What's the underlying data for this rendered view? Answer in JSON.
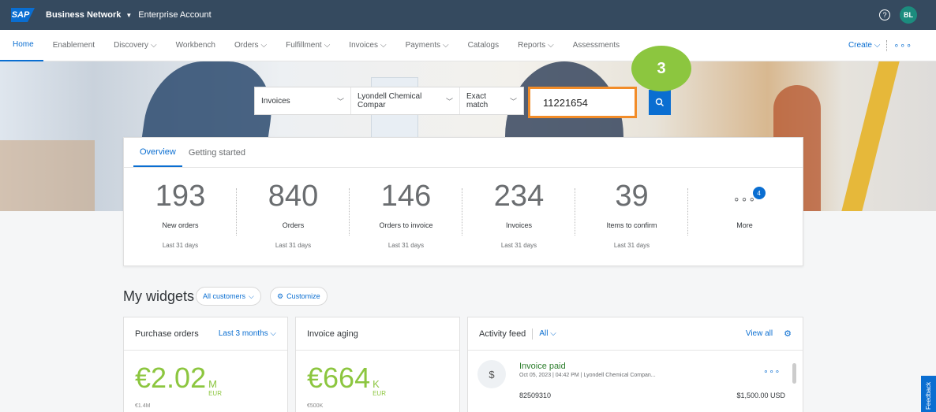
{
  "shell": {
    "logo": "SAP",
    "title": "Business Network",
    "account": "Enterprise Account",
    "avatar": "BL",
    "help": "?"
  },
  "nav": {
    "items": [
      {
        "label": "Home",
        "caret": false
      },
      {
        "label": "Enablement",
        "caret": false
      },
      {
        "label": "Discovery",
        "caret": true
      },
      {
        "label": "Workbench",
        "caret": false
      },
      {
        "label": "Orders",
        "caret": true
      },
      {
        "label": "Fulfillment",
        "caret": true
      },
      {
        "label": "Invoices",
        "caret": true
      },
      {
        "label": "Payments",
        "caret": true
      },
      {
        "label": "Catalogs",
        "caret": false
      },
      {
        "label": "Reports",
        "caret": true
      },
      {
        "label": "Assessments",
        "caret": false
      }
    ],
    "create_label": "Create"
  },
  "search": {
    "doc_type": "Invoices",
    "customer": "Lyondell Chemical Compar",
    "match": "Exact match",
    "query": "11221654"
  },
  "step_badge": "3",
  "overview": {
    "tabs": [
      "Overview",
      "Getting started"
    ],
    "kpis": [
      {
        "value": "193",
        "label": "New orders",
        "sub": "Last 31 days"
      },
      {
        "value": "840",
        "label": "Orders",
        "sub": "Last 31 days"
      },
      {
        "value": "146",
        "label": "Orders to invoice",
        "sub": "Last 31 days"
      },
      {
        "value": "234",
        "label": "Invoices",
        "sub": "Last 31 days"
      },
      {
        "value": "39",
        "label": "Items to confirm",
        "sub": "Last 31 days"
      }
    ],
    "more_label": "More",
    "more_count": "4"
  },
  "widgets": {
    "title": "My widgets",
    "customers_pill": "All customers",
    "customize_pill": "Customize"
  },
  "po_card": {
    "title": "Purchase orders",
    "period": "Last 3 months",
    "amount": "€2.02",
    "unit": "M",
    "currency": "EUR",
    "cut_text": "€1.4M"
  },
  "aging_card": {
    "title": "Invoice aging",
    "amount": "€664",
    "unit": "K",
    "currency": "EUR",
    "cut_text": "€500K"
  },
  "feed_card": {
    "title": "Activity feed",
    "filter": "All",
    "view_all": "View all",
    "item": {
      "title": "Invoice paid",
      "meta": "Oct 05, 2023 | 04:42 PM | Lyondell Chemical Compan...",
      "doc": "82509310",
      "amount": "$1,500.00 USD"
    }
  },
  "feedback_label": "Feedback",
  "colors": {
    "shell": "#354a5f",
    "accent": "#0a6ed1",
    "highlight": "#f28c28",
    "step": "#8cc63f"
  }
}
